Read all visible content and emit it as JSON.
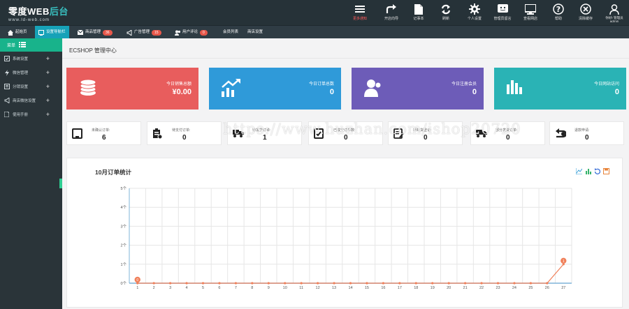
{
  "logo": {
    "main": "零度WEB",
    "accent": "后台",
    "sub": "www.ld-web.com"
  },
  "toolbar": [
    {
      "icon": "menu-icon",
      "label": "更多通知",
      "highlight": true
    },
    {
      "icon": "share-icon",
      "label": "开店向导"
    },
    {
      "icon": "notepad-icon",
      "label": "记事本"
    },
    {
      "icon": "refresh-icon",
      "label": "刷新"
    },
    {
      "icon": "gear-icon",
      "label": "个人设置"
    },
    {
      "icon": "message-icon",
      "label": "管理员留言"
    },
    {
      "icon": "monitor-icon",
      "label": "查看网店"
    },
    {
      "icon": "help-icon",
      "label": "帮助"
    },
    {
      "icon": "close-icon",
      "label": "清除缓存"
    }
  ],
  "user": {
    "greeting": "你好!",
    "role": "管理员",
    "name": "admin"
  },
  "tabs": [
    {
      "icon": "home-icon",
      "label": "起始页"
    },
    {
      "icon": "dashboard-icon",
      "label": "设置导航栏",
      "active": true
    },
    {
      "icon": "mail-icon",
      "label": "商品管理",
      "badge": "36"
    },
    {
      "icon": "megaphone-icon",
      "label": "广告管理",
      "badge": "15"
    },
    {
      "icon": "users-icon",
      "label": "用户评论",
      "badge": "0"
    },
    {
      "label": "会员列表"
    },
    {
      "label": "商店设置"
    }
  ],
  "sidebar": {
    "header": "菜单",
    "items": [
      {
        "icon": "checkbox-icon",
        "label": "系统设置"
      },
      {
        "icon": "bolt-icon",
        "label": "微信管理"
      },
      {
        "icon": "book-icon",
        "label": "分销设置"
      },
      {
        "icon": "megaphone-icon",
        "label": "商店微信设置"
      },
      {
        "icon": "doc-icon",
        "label": "使用手册"
      }
    ]
  },
  "main": {
    "title": "ECSHOP 管理中心",
    "stats": [
      {
        "label": "今日销售总额",
        "value": "¥0.00",
        "color": "#e85d5d",
        "icon": "coins-icon"
      },
      {
        "label": "今日订单总数",
        "value": "0",
        "color": "#2f9ad9",
        "icon": "trend-icon"
      },
      {
        "label": "今日注册会员",
        "value": "0",
        "color": "#6d5cb8",
        "icon": "members-icon"
      },
      {
        "label": "今日网站访问",
        "value": "0",
        "color": "#2ab3b5",
        "icon": "bars-icon"
      }
    ],
    "orders": [
      {
        "icon": "tablet-icon",
        "label": "未确认订单:",
        "value": "6"
      },
      {
        "icon": "clipboard-icon",
        "label": "待支付订单:",
        "value": "0"
      },
      {
        "icon": "truck-icon",
        "label": "待发货订单:",
        "value": "1"
      },
      {
        "icon": "check-doc-icon",
        "label": "已成交订单数:",
        "value": "0"
      },
      {
        "icon": "edit-doc-icon",
        "label": "新缺货登记:",
        "value": "0"
      },
      {
        "icon": "truck-icon",
        "label": "部分发货订单:",
        "value": "0"
      },
      {
        "icon": "return-icon",
        "label": "退款申请:",
        "value": "0"
      }
    ]
  },
  "watermark": "https://www.huzhan.com/ishop20720",
  "chart_data": {
    "type": "line",
    "title": "10月订单统计",
    "x": [
      1,
      2,
      3,
      4,
      5,
      6,
      7,
      8,
      9,
      10,
      11,
      12,
      13,
      14,
      15,
      16,
      17,
      18,
      19,
      20,
      21,
      22,
      23,
      24,
      25,
      26,
      27
    ],
    "series": [
      {
        "values": [
          0,
          0,
          0,
          0,
          0,
          0,
          0,
          0,
          0,
          0,
          0,
          0,
          0,
          0,
          0,
          0,
          0,
          0,
          0,
          0,
          0,
          0,
          0,
          0,
          0,
          0,
          1
        ]
      }
    ],
    "y_ticks": [
      "0个",
      "1个",
      "2个",
      "3个",
      "4个",
      "5个"
    ],
    "ylim": [
      0,
      5
    ],
    "point_labels": {
      "first": "0",
      "last": "1"
    },
    "color": "#f0805a",
    "grid": true
  }
}
